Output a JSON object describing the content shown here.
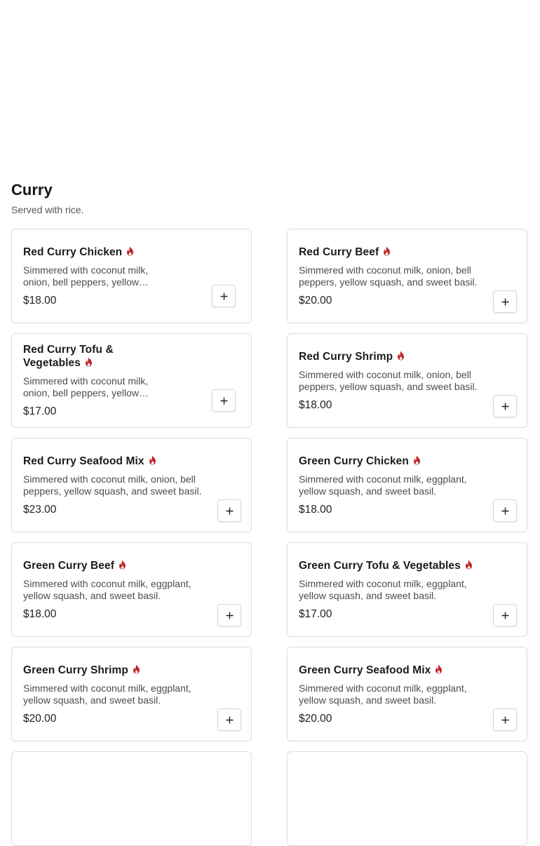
{
  "section": {
    "title": "Curry",
    "subtitle": "Served with rice."
  },
  "colors": {
    "flame": "#c0282d",
    "border": "#dcdcdc"
  },
  "icons": {
    "spicy": "flame-icon",
    "add": "plus-icon"
  },
  "items": [
    {
      "name": "Red Curry Chicken",
      "desc": "Simmered with coconut milk, onion, bell peppers, yellow squash, and sweet basil.",
      "price": "$18.00",
      "spicy": true
    },
    {
      "name": "Red Curry Beef",
      "desc": "Simmered with coconut milk, onion, bell peppers, yellow squash, and sweet basil.",
      "price": "$20.00",
      "spicy": true
    },
    {
      "name": "Red Curry Tofu & Vegetables",
      "desc": "Simmered with coconut milk, onion, bell peppers, yellow squash, and sweet basil.",
      "price": "$17.00",
      "spicy": true
    },
    {
      "name": "Red Curry Shrimp",
      "desc": "Simmered with coconut milk, onion, bell peppers, yellow squash, and sweet basil.",
      "price": "$18.00",
      "spicy": true
    },
    {
      "name": "Red Curry Seafood Mix",
      "desc": "Simmered with coconut milk, onion, bell peppers, yellow squash, and sweet basil.",
      "price": "$23.00",
      "spicy": true
    },
    {
      "name": "Green Curry Chicken",
      "desc": "Simmered with coconut milk, eggplant, yellow squash, and sweet basil.",
      "price": "$18.00",
      "spicy": true
    },
    {
      "name": "Green Curry Beef",
      "desc": "Simmered with coconut milk, eggplant, yellow squash, and sweet basil.",
      "price": "$18.00",
      "spicy": true
    },
    {
      "name": "Green Curry Tofu & Vegetables",
      "desc": "Simmered with coconut milk, eggplant, yellow squash, and sweet basil.",
      "price": "$17.00",
      "spicy": true
    },
    {
      "name": "Green Curry Shrimp",
      "desc": "Simmered with coconut milk, eggplant, yellow squash, and sweet basil.",
      "price": "$20.00",
      "spicy": true
    },
    {
      "name": "Green Curry Seafood Mix",
      "desc": "Simmered with coconut milk, eggplant, yellow squash, and sweet basil.",
      "price": "$20.00",
      "spicy": true
    }
  ]
}
